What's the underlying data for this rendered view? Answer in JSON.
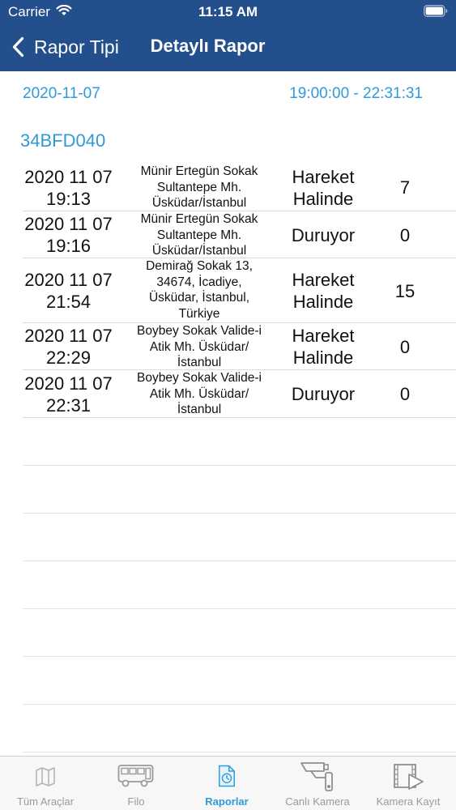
{
  "status_bar": {
    "carrier": "Carrier",
    "time": "11:15 AM"
  },
  "nav": {
    "back_label": "Rapor Tipi",
    "title": "Detaylı Rapor"
  },
  "report": {
    "date": "2020-11-07",
    "time_range": "19:00:00 - 22:31:31",
    "plate": "34BFD040"
  },
  "rows": [
    {
      "date": "2020 11 07",
      "time": "19:13",
      "address": [
        "Münir Ertegün Sokak",
        "Sultantepe Mh.",
        "Üsküdar/İstanbul"
      ],
      "status": [
        "Hareket",
        "Halinde"
      ],
      "count": "7"
    },
    {
      "date": "2020 11 07",
      "time": "19:16",
      "address": [
        "Münir Ertegün Sokak",
        "Sultantepe Mh.",
        "Üsküdar/İstanbul"
      ],
      "status": [
        "Duruyor"
      ],
      "count": "0"
    },
    {
      "date": "2020 11 07",
      "time": "21:54",
      "address": [
        "Demirağ Sokak 13,",
        "34674, İcadiye,",
        "Üsküdar, İstanbul,",
        "Türkiye"
      ],
      "status": [
        "Hareket",
        "Halinde"
      ],
      "count": "15"
    },
    {
      "date": "2020 11 07",
      "time": "22:29",
      "address": [
        "Boybey Sokak Valide-i",
        "Atik Mh. Üsküdar/",
        "İstanbul"
      ],
      "status": [
        "Hareket",
        "Halinde"
      ],
      "count": "0"
    },
    {
      "date": "2020 11 07",
      "time": "22:31",
      "address": [
        "Boybey Sokak Valide-i",
        "Atik Mh. Üsküdar/",
        "İstanbul"
      ],
      "status": [
        "Duruyor"
      ],
      "count": "0"
    }
  ],
  "tabs": [
    {
      "label": "Tüm Araçlar",
      "icon": "map-icon",
      "active": false
    },
    {
      "label": "Filo",
      "icon": "bus-icon",
      "active": false
    },
    {
      "label": "Raporlar",
      "icon": "report-clock-icon",
      "active": true
    },
    {
      "label": "Canlı Kamera",
      "icon": "security-camera-icon",
      "active": false
    },
    {
      "label": "Kamera Kayıt",
      "icon": "video-play-icon",
      "active": false
    }
  ],
  "colors": {
    "header": "#23508d",
    "accent": "#2f9ad8",
    "tab_inactive": "#9a9a9a"
  }
}
